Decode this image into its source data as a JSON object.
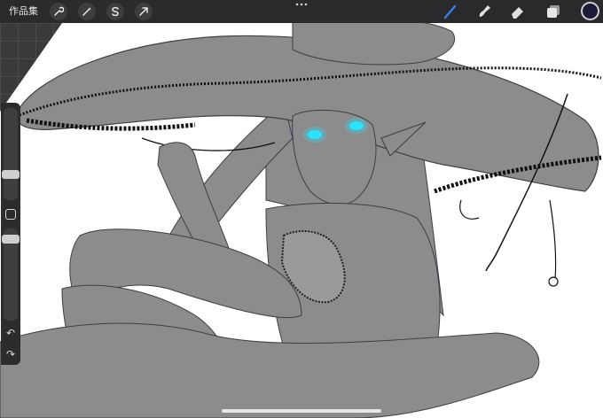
{
  "topbar": {
    "gallery_label": "作品集",
    "actions_icons": [
      "wrench-icon",
      "magic-wand-icon",
      "selection-s-icon",
      "transform-arrow-icon"
    ],
    "more_icon": "more-dots-icon",
    "tools_icons": [
      "brush-icon",
      "smudge-icon",
      "eraser-icon",
      "layers-icon"
    ],
    "active_tool_color": "#3b82f6",
    "current_color": "#1b1a38"
  },
  "sidebar": {
    "brush_size_level": 0.45,
    "opacity_level": 0.9,
    "modify_icon": "square-modify-icon",
    "undo_symbol": "↶",
    "redo_symbol": "↷"
  },
  "canvas": {
    "background": "#ffffff",
    "fill_color": "#8c8c8c",
    "eye_glow_color": "#27e4ff"
  }
}
